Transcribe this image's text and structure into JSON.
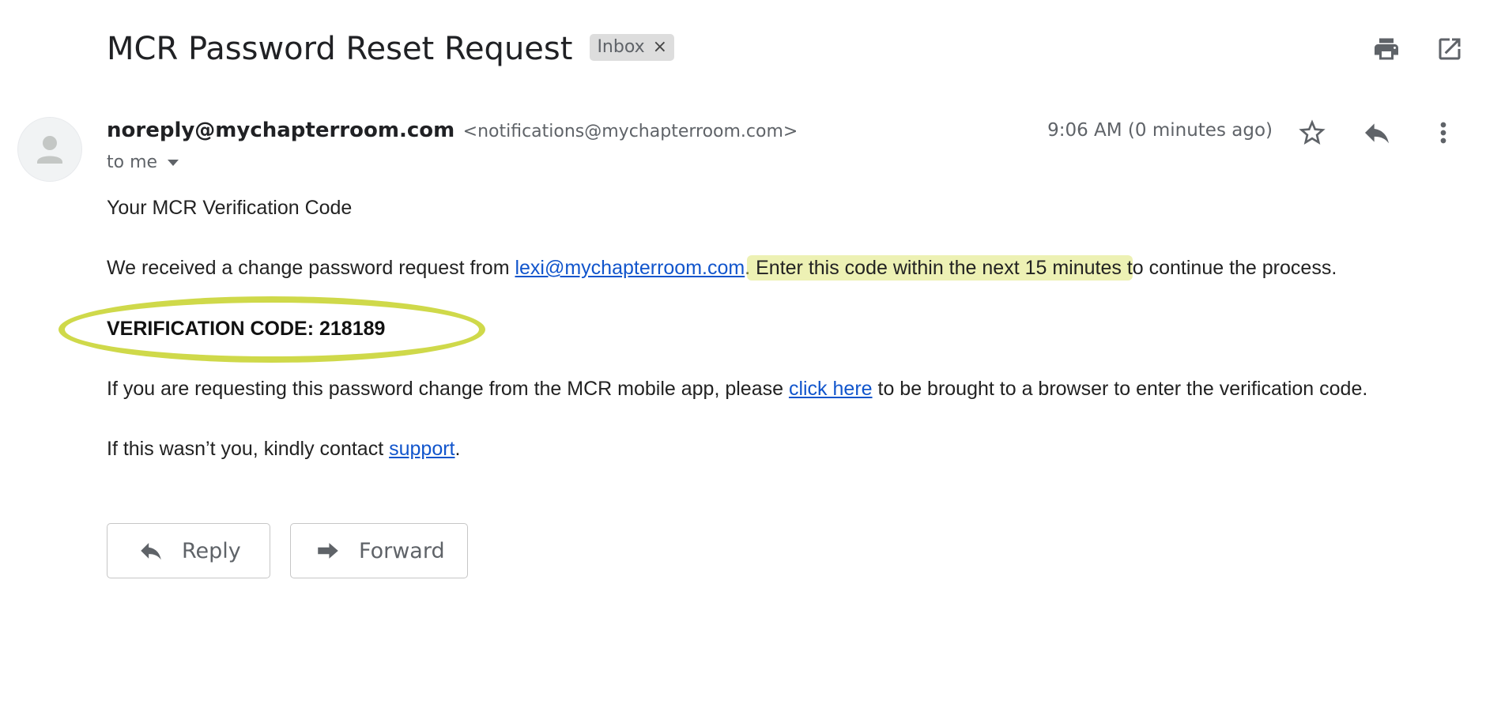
{
  "email": {
    "subject": "MCR Password Reset Request",
    "label": "Inbox",
    "label_remove": "×",
    "sender_name": "noreply@mychapterroom.com",
    "sender_email": "<notifications@mychapterroom.com>",
    "recipient": "to me",
    "time": "9:06 AM (0 minutes ago)"
  },
  "body": {
    "heading": "Your MCR Verification Code",
    "p1_before": "We received a change password request from ",
    "p1_link": "lexi@mychapterroom.com",
    "p1_dot": ".",
    "p1_highlight": " Enter this code within the next 15 minutes t",
    "p1_after": "o continue the process.",
    "code": "VERIFICATION CODE: 218189",
    "p2_before": "If you are requesting this password change from the MCR mobile app, please ",
    "p2_link": "click here",
    "p2_after": " to be brought to a browser to enter the verification code.",
    "p3_before": "If this wasn’t you, kindly contact ",
    "p3_link": "support",
    "p3_after": "."
  },
  "actions": {
    "reply": "Reply",
    "forward": "Forward"
  },
  "icons": {
    "print": "print-icon",
    "popout": "open-in-new-window-icon",
    "star": "star-icon",
    "reply": "reply-icon",
    "more": "more-vert-icon",
    "avatar": "person-icon",
    "dropdown": "caret-down-icon",
    "forward": "forward-icon"
  },
  "colors": {
    "highlight": "#d6e058",
    "ellipse": "#cfd94a",
    "link": "#1155cc",
    "label_bg": "#dddddd"
  }
}
